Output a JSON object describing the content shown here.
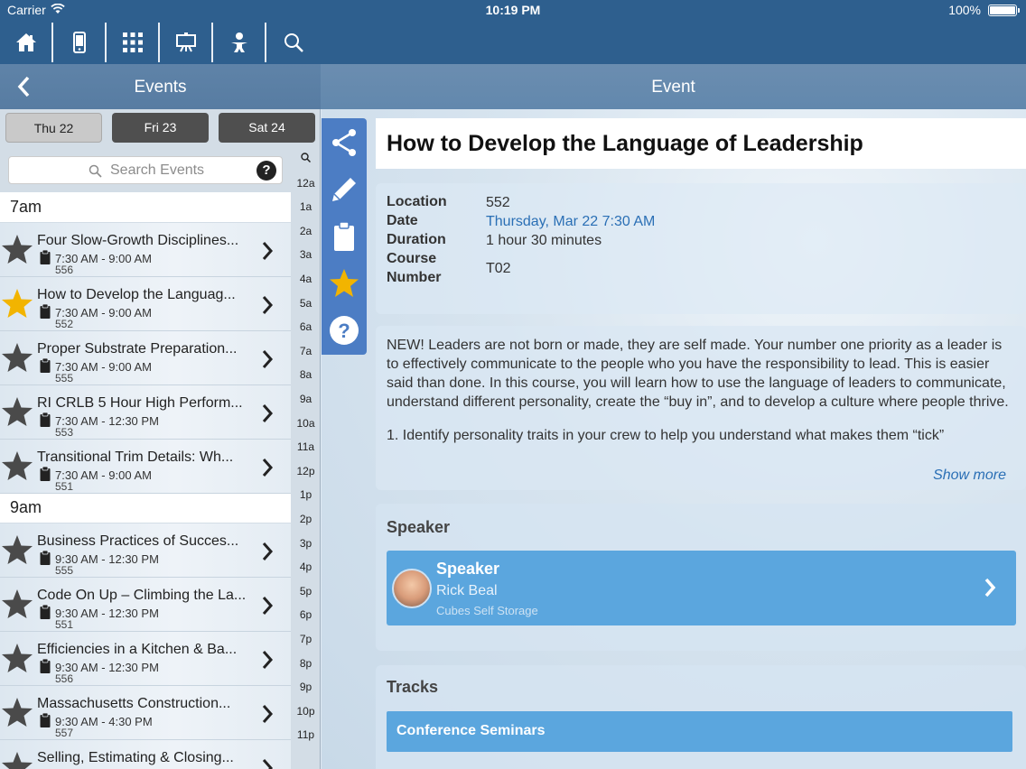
{
  "status_bar": {
    "carrier": "Carrier",
    "time": "10:19 PM",
    "battery": "100%"
  },
  "nav_icons": [
    "home-icon",
    "mobile-device-icon",
    "grid-icon",
    "presentation-board-icon",
    "person-icon",
    "search-icon"
  ],
  "left_header": {
    "title": "Events"
  },
  "right_header": {
    "title": "Event"
  },
  "days": [
    {
      "label": "Thu 22",
      "selected": true
    },
    {
      "label": "Fri 23",
      "selected": false
    },
    {
      "label": "Sat 24",
      "selected": false
    }
  ],
  "search": {
    "placeholder": "Search Events",
    "help": "?"
  },
  "hours": [
    {
      "label": "7am"
    },
    {
      "label": "9am"
    }
  ],
  "events": [
    {
      "title": "Four Slow-Growth Disciplines...",
      "time": "7:30 AM - 9:00 AM",
      "room": "556",
      "favorite": false
    },
    {
      "title": "How to Develop the Languag...",
      "time": "7:30 AM - 9:00 AM",
      "room": "552",
      "favorite": true
    },
    {
      "title": "Proper Substrate Preparation...",
      "time": "7:30 AM - 9:00 AM",
      "room": "555",
      "favorite": false
    },
    {
      "title": "RI CRLB 5 Hour High Perform...",
      "time": "7:30 AM - 12:30 PM",
      "room": "553",
      "favorite": false
    },
    {
      "title": "Transitional Trim Details: Wh...",
      "time": "7:30 AM - 9:00 AM",
      "room": "551",
      "favorite": false
    },
    {
      "title": "Business Practices of Succes...",
      "time": "9:30 AM - 12:30 PM",
      "room": "555",
      "favorite": false
    },
    {
      "title": "Code On Up – Climbing the La...",
      "time": "9:30 AM - 12:30 PM",
      "room": "551",
      "favorite": false
    },
    {
      "title": "Efficiencies in a Kitchen & Ba...",
      "time": "9:30 AM - 12:30 PM",
      "room": "556",
      "favorite": false
    },
    {
      "title": "Massachusetts Construction...",
      "time": "9:30 AM - 4:30 PM",
      "room": "557",
      "favorite": false
    },
    {
      "title": "Selling, Estimating & Closing...",
      "time": "",
      "room": "",
      "favorite": false
    }
  ],
  "time_index": [
    "Q",
    "12a",
    "1a",
    "2a",
    "3a",
    "4a",
    "5a",
    "6a",
    "7a",
    "8a",
    "9a",
    "10a",
    "11a",
    "12p",
    "1p",
    "2p",
    "3p",
    "4p",
    "5p",
    "6p",
    "7p",
    "8p",
    "9p",
    "10p",
    "11p"
  ],
  "actions": [
    "share-icon",
    "pencil-icon",
    "clipboard-icon",
    "star-icon",
    "help-icon"
  ],
  "event": {
    "title": "How to Develop the Language of Leadership",
    "details": {
      "location_label": "Location",
      "location": "552",
      "date_label": "Date",
      "date": "Thursday, Mar 22 7:30 AM",
      "duration_label": "Duration",
      "duration": "1 hour 30 minutes",
      "course_label_1": "Course",
      "course_label_2": "Number",
      "course": "T02"
    },
    "description_1": "NEW! Leaders are not born or made, they are self made.  Your number one priority as a leader is to effectively communicate to the people who you have the responsibility to lead. This is easier said than done. In this course, you will learn how to use the language of leaders to communicate, understand different personality, create the “buy in”,  and to develop a culture where people thrive.",
    "description_2": "1. Identify personality traits in your crew to help you understand what makes them “tick”",
    "show_more": "Show more",
    "speaker_section": "Speaker",
    "speaker": {
      "label": "Speaker",
      "name": "Rick Beal",
      "org": "Cubes Self Storage"
    },
    "tracks_section": "Tracks",
    "track": "Conference Seminars"
  },
  "colors": {
    "topbar": "#2e5f8e",
    "accent": "#5ba6de",
    "link": "#2a6fb5",
    "action_strip": "#4c7dc4",
    "star_on": "#f2b400"
  }
}
